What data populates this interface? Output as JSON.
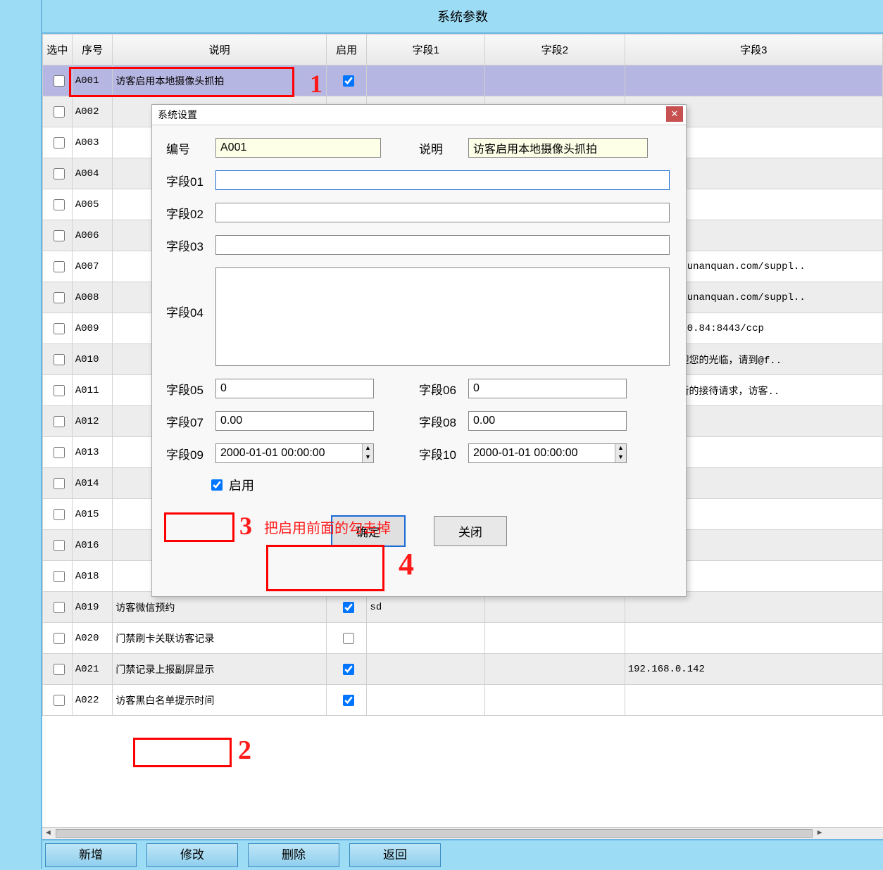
{
  "page_title": "系统参数",
  "columns": {
    "select": "选中",
    "id": "序号",
    "desc": "说明",
    "enable": "启用",
    "f1": "字段1",
    "f2": "字段2",
    "f3": "字段3"
  },
  "rows": [
    {
      "id": "A001",
      "desc": "访客启用本地摄像头抓拍",
      "en": true,
      "f1": "",
      "f2": "",
      "f3": "",
      "selected": true
    },
    {
      "id": "A002",
      "desc": "",
      "en": null,
      "f1": "",
      "f2": "",
      "f3": ""
    },
    {
      "id": "A003",
      "desc": "",
      "en": null,
      "f1": "",
      "f2": "",
      "f3": ""
    },
    {
      "id": "A004",
      "desc": "",
      "en": null,
      "f1": "",
      "f2": "",
      "f3": ""
    },
    {
      "id": "A005",
      "desc": "",
      "en": null,
      "f1": "",
      "f2": "",
      "f3": ""
    },
    {
      "id": "A006",
      "desc": "",
      "en": null,
      "f1": "",
      "f2": "",
      "f3": ""
    },
    {
      "id": "A007",
      "desc": "",
      "en": null,
      "f1": "",
      "f2": "",
      "f3": "//www.renrunanquan.com/suppl.."
    },
    {
      "id": "A008",
      "desc": "",
      "en": null,
      "f1": "",
      "f2": "",
      "f3": "//www.renrunanquan.com/suppl.."
    },
    {
      "id": "A009",
      "desc": "",
      "en": null,
      "f1": "",
      "f2": "",
      "f3": "://47.104.0.84:8443/ccp"
    },
    {
      "id": "A010",
      "desc": "",
      "en": null,
      "f1": "",
      "f2": "",
      "f3": "@fkaa02欢迎您的光临，请到@f.."
    },
    {
      "id": "A011",
      "desc": "",
      "en": null,
      "f1": "",
      "f2": "",
      "f3": "@fkab02有新的接待请求，访客.."
    },
    {
      "id": "A012",
      "desc": "",
      "en": null,
      "f1": "",
      "f2": "",
      "f3": ""
    },
    {
      "id": "A013",
      "desc": "",
      "en": null,
      "f1": "",
      "f2": "",
      "f3": ""
    },
    {
      "id": "A014",
      "desc": "",
      "en": null,
      "f1": "",
      "f2": "",
      "f3": ""
    },
    {
      "id": "A015",
      "desc": "",
      "en": null,
      "f1": "",
      "f2": "",
      "f3": ""
    },
    {
      "id": "A016",
      "desc": "",
      "en": null,
      "f1": "",
      "f2": "",
      "f3": ""
    },
    {
      "id": "A018",
      "desc": "",
      "en": null,
      "f1": "",
      "f2": "",
      "f3": ""
    },
    {
      "id": "A019",
      "desc": "访客微信预约",
      "en": true,
      "f1": "sd",
      "f2": "",
      "f3": ""
    },
    {
      "id": "A020",
      "desc": "门禁刷卡关联访客记录",
      "en": false,
      "f1": "",
      "f2": "",
      "f3": ""
    },
    {
      "id": "A021",
      "desc": "门禁记录上报副屏显示",
      "en": true,
      "f1": "",
      "f2": "",
      "f3": "192.168.0.142"
    },
    {
      "id": "A022",
      "desc": "访客黑白名单提示时间",
      "en": true,
      "f1": "",
      "f2": "",
      "f3": ""
    }
  ],
  "dialog": {
    "title": "系统设置",
    "labels": {
      "id": "编号",
      "desc": "说明",
      "f01": "字段01",
      "f02": "字段02",
      "f03": "字段03",
      "f04": "字段04",
      "f05": "字段05",
      "f06": "字段06",
      "f07": "字段07",
      "f08": "字段08",
      "f09": "字段09",
      "f10": "字段10",
      "enable": "启用"
    },
    "values": {
      "id": "A001",
      "desc": "访客启用本地摄像头抓拍",
      "f01": "",
      "f02": "",
      "f03": "",
      "f04": "",
      "f05": "0",
      "f06": "0",
      "f07": "0.00",
      "f08": "0.00",
      "f09": "2000-01-01 00:00:00",
      "f10": "2000-01-01 00:00:00",
      "enable": true
    },
    "buttons": {
      "ok": "确定",
      "close": "关闭"
    }
  },
  "footer": {
    "add": "新增",
    "edit": "修改",
    "del": "删除",
    "back": "返回"
  },
  "annotations": {
    "n1": "1",
    "n2": "2",
    "n3": "3",
    "n4": "4",
    "text3": "把启用前面的勾去掉"
  }
}
